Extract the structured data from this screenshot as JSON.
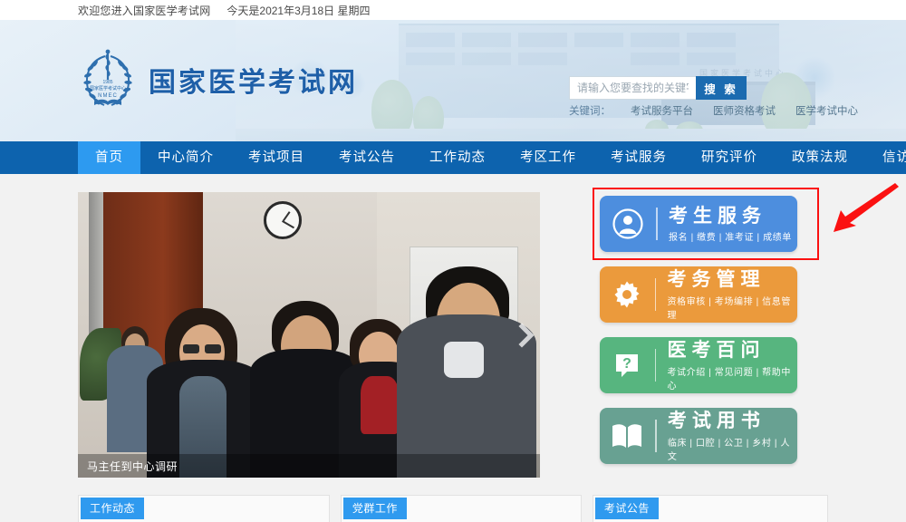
{
  "topbar": {
    "welcome": "欢迎您进入国家医学考试网",
    "date": "今天是2021年3月18日 星期四"
  },
  "header": {
    "site_title": "国家医学考试网",
    "logo_org": "国家医学考试中心",
    "logo_abbr": "NMEC",
    "logo_year": "1985",
    "building_sign": "国家医学考试中心"
  },
  "search": {
    "placeholder": "请输入您要查找的关键字",
    "value": "",
    "button_label": "搜 索",
    "keyword_label": "关键词：",
    "keywords": [
      "考试服务平台",
      "医师资格考试",
      "医学考试中心"
    ]
  },
  "nav": {
    "items": [
      {
        "label": "首页",
        "active": true
      },
      {
        "label": "中心简介",
        "active": false
      },
      {
        "label": "考试项目",
        "active": false
      },
      {
        "label": "考试公告",
        "active": false
      },
      {
        "label": "工作动态",
        "active": false
      },
      {
        "label": "考区工作",
        "active": false
      },
      {
        "label": "考试服务",
        "active": false
      },
      {
        "label": "研究评价",
        "active": false
      },
      {
        "label": "政策法规",
        "active": false
      },
      {
        "label": "信访工作",
        "active": false
      }
    ]
  },
  "carousel": {
    "caption": "马主任到中心调研",
    "next_icon": "chevron-right-icon"
  },
  "cards": [
    {
      "title": "考生服务",
      "subtitle": "报名 | 缴费 | 准考证 | 成绩单",
      "icon": "user-circle-icon",
      "color": "#4d8ede",
      "highlighted": true
    },
    {
      "title": "考务管理",
      "subtitle": "资格审核 | 考场编排 | 信息管理",
      "icon": "gear-icon",
      "color": "#eb9a3c",
      "highlighted": false
    },
    {
      "title": "医考百问",
      "subtitle": "考试介绍 | 常见问题 | 帮助中心",
      "icon": "question-bubble-icon",
      "color": "#57b57f",
      "highlighted": false
    },
    {
      "title": "考试用书",
      "subtitle": "临床 | 口腔 | 公卫 | 乡村 | 人文",
      "icon": "book-icon",
      "color": "#68a192",
      "highlighted": false
    }
  ],
  "bottom_panels": [
    {
      "tab": "工作动态"
    },
    {
      "tab": "党群工作"
    },
    {
      "tab": "考试公告"
    }
  ],
  "annotation": {
    "arrow_color": "#fb1111",
    "box_color": "#fb1111"
  },
  "colors": {
    "nav_bg": "#0d63ae",
    "nav_active": "#2d9af0",
    "brand_blue": "#1e5fa8",
    "search_btn": "#1b6bb0",
    "tab_blue": "#2f9aef"
  }
}
